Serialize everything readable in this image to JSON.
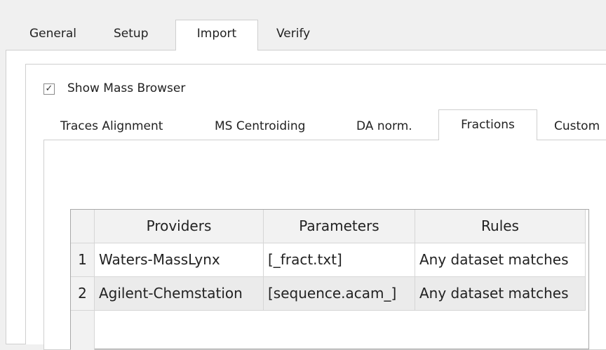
{
  "outer_tabs": {
    "general": "General",
    "setup": "Setup",
    "import": "Import",
    "verify": "Verify",
    "selected": "Import"
  },
  "show_mass_browser": {
    "label": "Show Mass Browser",
    "checked": true,
    "check_glyph": "✓"
  },
  "inner_tabs": {
    "traces": "Traces Alignment",
    "ms": "MS Centroiding",
    "da": "DA norm.",
    "fractions": "Fractions",
    "custom": "Custom",
    "selected": "Fractions"
  },
  "grid": {
    "columns": [
      "Providers",
      "Parameters",
      "Rules"
    ],
    "rows": [
      {
        "num": "1",
        "provider": "Waters-MassLynx",
        "parameters": "[_fract.txt]",
        "rules": "Any dataset matches"
      },
      {
        "num": "2",
        "provider": "Agilent-Chemstation",
        "parameters": "[sequence.acam_]",
        "rules": "Any dataset matches"
      }
    ]
  },
  "colors": {
    "tab_border": "#cfcfcf",
    "header_bg": "#f2f2f2",
    "row_alt_bg": "#ebebeb"
  }
}
